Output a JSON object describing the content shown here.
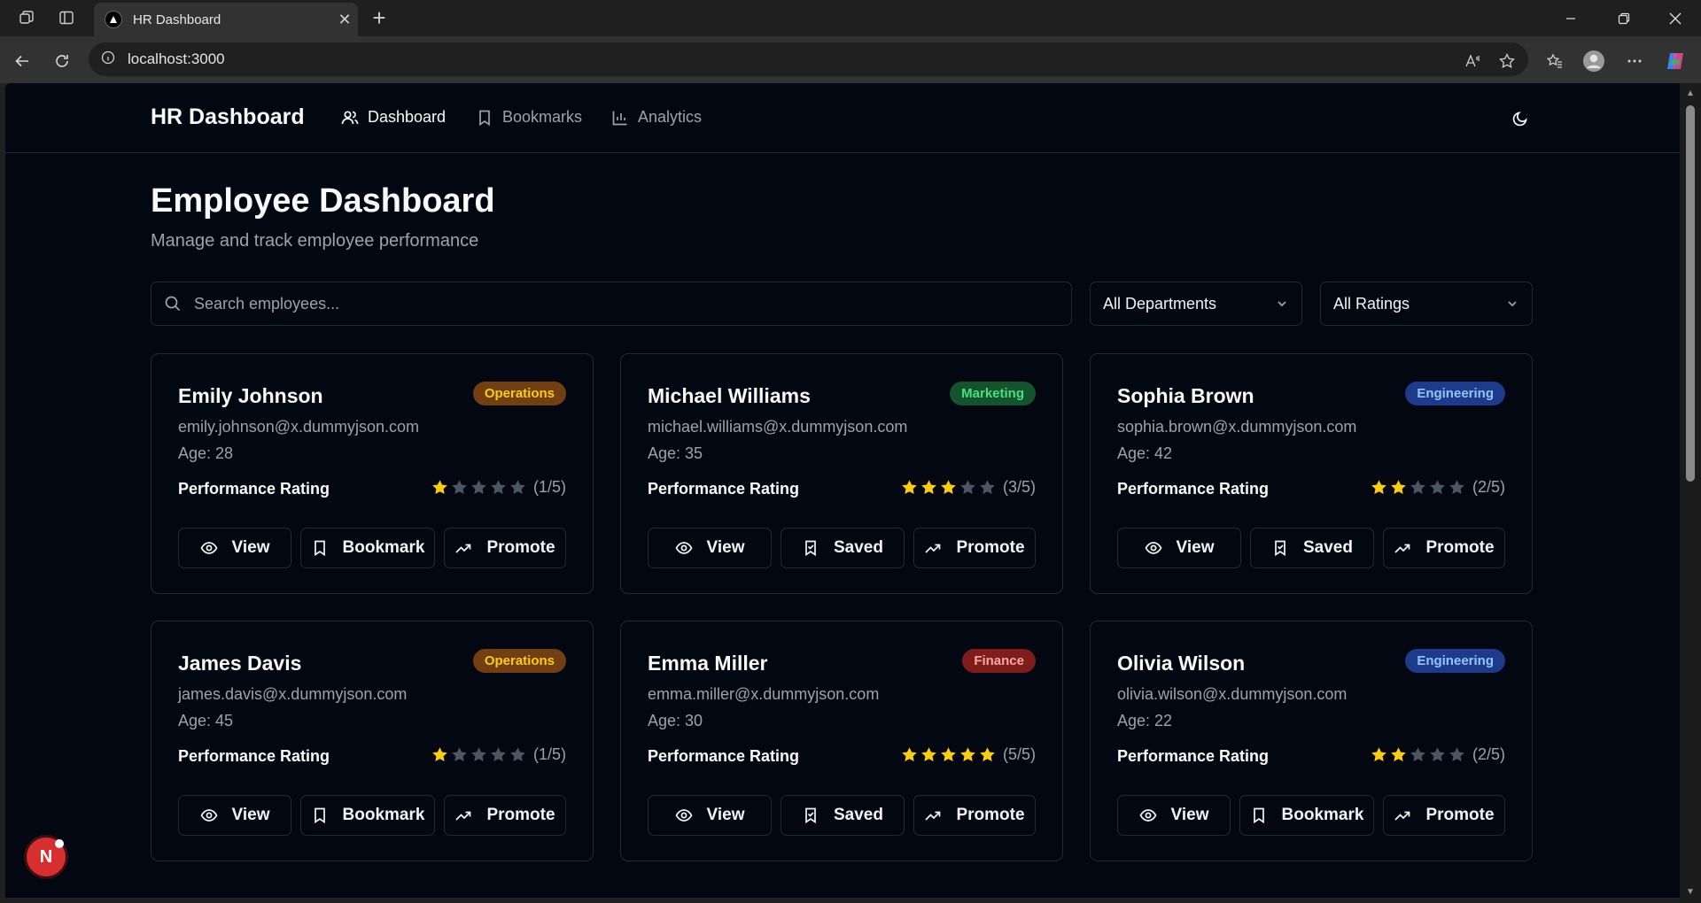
{
  "browser": {
    "tab_title": "HR Dashboard",
    "url": "localhost:3000"
  },
  "nav": {
    "brand": "HR Dashboard",
    "links": [
      {
        "label": "Dashboard",
        "icon": "users-icon",
        "active": true
      },
      {
        "label": "Bookmarks",
        "icon": "bookmark-icon",
        "active": false
      },
      {
        "label": "Analytics",
        "icon": "bar-chart-icon",
        "active": false
      }
    ]
  },
  "page": {
    "title": "Employee Dashboard",
    "subtitle": "Manage and track employee performance"
  },
  "filters": {
    "search_placeholder": "Search employees...",
    "department": "All Departments",
    "rating": "All Ratings"
  },
  "labels": {
    "performance": "Performance Rating",
    "view": "View",
    "promote": "Promote"
  },
  "employees": [
    {
      "name": "Emily Johnson",
      "email": "emily.johnson@x.dummyjson.com",
      "age": "Age: 28",
      "dept": "Operations",
      "rating": 1,
      "score": "(1/5)",
      "bookmark": "Bookmark"
    },
    {
      "name": "Michael Williams",
      "email": "michael.williams@x.dummyjson.com",
      "age": "Age: 35",
      "dept": "Marketing",
      "rating": 3,
      "score": "(3/5)",
      "bookmark": "Saved"
    },
    {
      "name": "Sophia Brown",
      "email": "sophia.brown@x.dummyjson.com",
      "age": "Age: 42",
      "dept": "Engineering",
      "rating": 2,
      "score": "(2/5)",
      "bookmark": "Saved"
    },
    {
      "name": "James Davis",
      "email": "james.davis@x.dummyjson.com",
      "age": "Age: 45",
      "dept": "Operations",
      "rating": 1,
      "score": "(1/5)",
      "bookmark": "Bookmark"
    },
    {
      "name": "Emma Miller",
      "email": "emma.miller@x.dummyjson.com",
      "age": "Age: 30",
      "dept": "Finance",
      "rating": 5,
      "score": "(5/5)",
      "bookmark": "Saved"
    },
    {
      "name": "Olivia Wilson",
      "email": "olivia.wilson@x.dummyjson.com",
      "age": "Age: 22",
      "dept": "Engineering",
      "rating": 2,
      "score": "(2/5)",
      "bookmark": "Bookmark"
    }
  ],
  "dev_badge": "N",
  "colors": {
    "page_bg": "#030712",
    "star_filled": "#facc15",
    "star_empty": "#4b5563"
  }
}
